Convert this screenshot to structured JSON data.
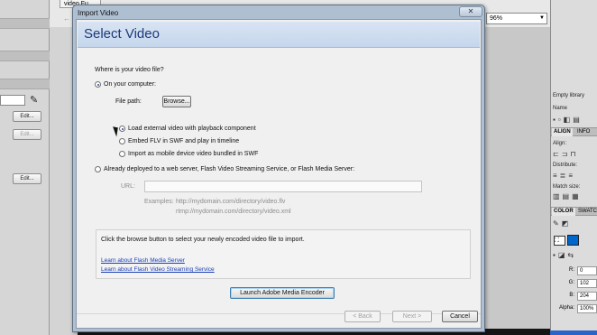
{
  "background_app": {
    "document_tab": "video Fu...",
    "back_arrow": "←",
    "zoom": "96%",
    "left_panel": {
      "edit_buttons": [
        "Edit...",
        "Edit...",
        "Edit..."
      ]
    },
    "right_panel": {
      "library_empty": "Empty library",
      "name_header": "Name",
      "tabs_align": [
        "ALIGN",
        "INFO"
      ],
      "align_label": "Align:",
      "distribute_label": "Distribute:",
      "match_size_label": "Match size:",
      "tabs_color": [
        "COLOR",
        "SWATC"
      ],
      "r_label": "R:",
      "r_value": "0",
      "g_label": "G:",
      "g_value": "102",
      "b_label": "B:",
      "b_value": "204",
      "alpha_label": "Alpha:",
      "alpha_value": "100%",
      "fill_color": "#0066cc"
    }
  },
  "dialog": {
    "window_title": "Import Video",
    "close_glyph": "✕",
    "heading": "Select Video",
    "question": "Where is your video file?",
    "option_computer": "On your computer:",
    "file_path_label": "File path:",
    "browse_button": "Browse...",
    "sub_options": [
      "Load external video with playback component",
      "Embed FLV in SWF and play in timeline",
      "Import as mobile device video bundled in SWF"
    ],
    "option_server": "Already deployed to a web server, Flash Video Streaming Service, or Flash Media Server:",
    "url_label": "URL:",
    "examples_label": "Examples:",
    "example_http": "http://mydomain.com/directory/video.flv",
    "example_rtmp": "rtmp://mydomain.com/directory/video.xml",
    "info_text": "Click the browse button to select your newly encoded video file to import.",
    "link_fms": "Learn about Flash Media Server",
    "link_fvss": "Learn about Flash Video Streaming Service",
    "encoder_button": "Launch Adobe Media Encoder",
    "back_button": "< Back",
    "next_button": "Next >",
    "cancel_button": "Cancel",
    "accent": "#1d3a7a"
  }
}
